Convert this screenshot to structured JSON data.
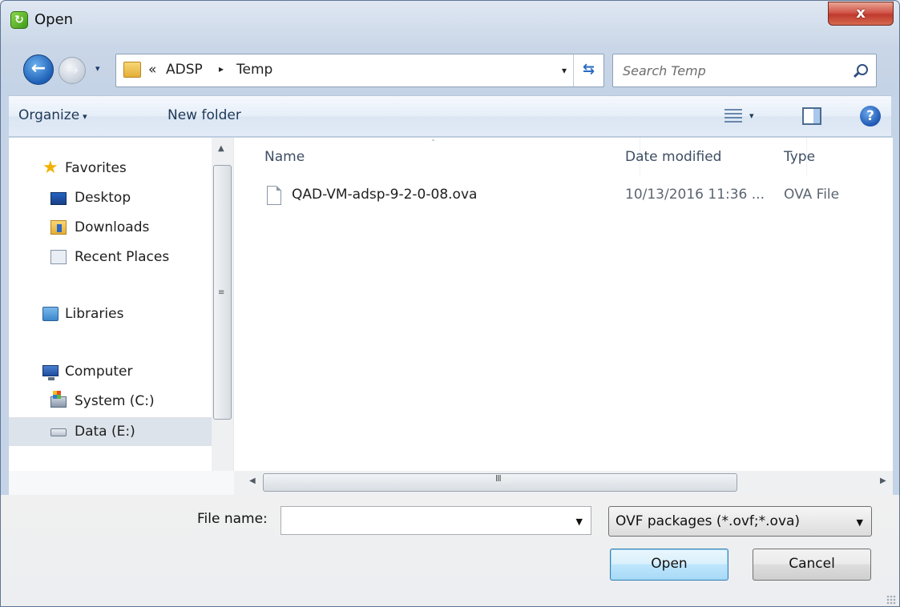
{
  "window": {
    "title": "Open",
    "close_label": "x"
  },
  "navigation": {
    "back_arrow": "←",
    "forward_arrow": "→",
    "history_caret": "▾",
    "breadcrumb": {
      "overflow": "«",
      "items": [
        "ADSP",
        "Temp"
      ],
      "separator": "▸"
    },
    "address_caret": "▾",
    "refresh_glyph": "⇆",
    "search_placeholder": "Search Temp"
  },
  "toolbar": {
    "organize_label": "Organize",
    "caret": "▾",
    "new_folder_label": "New folder",
    "view_caret": "▾",
    "help_glyph": "?"
  },
  "sidebar": {
    "favorites": "Favorites",
    "desktop": "Desktop",
    "downloads": "Downloads",
    "recent_places": "Recent Places",
    "libraries": "Libraries",
    "computer": "Computer",
    "system_drive": "System (C:)",
    "data_drive": "Data (E:)",
    "star_glyph": "★"
  },
  "file_list": {
    "columns": [
      "Name",
      "Date modified",
      "Type"
    ],
    "sort_glyph": "ˆ",
    "rows": [
      {
        "name": "QAD-VM-adsp-9-2-0-08.ova",
        "date_modified": "10/13/2016 11:36 ...",
        "type": "OVA File"
      }
    ]
  },
  "scrollbars": {
    "up": "▲",
    "down": "▼",
    "left": "◀",
    "right": "▶",
    "v_grip": "≡",
    "h_grip": "III"
  },
  "footer": {
    "file_name_label": "File name:",
    "file_name_value": "",
    "file_name_caret": "▼",
    "filter_value": "OVF packages (*.ovf;*.ova)",
    "filter_caret": "▼",
    "open_button": "Open",
    "cancel_button": "Cancel"
  },
  "colors": {
    "accent": "#3c7fb1",
    "close_button": "#c03a2e",
    "favorites_star": "#f2b100",
    "selected_row": "#dde3ea"
  },
  "icons": {
    "app": "vsphere-app-icon",
    "folder": "folder-icon",
    "search": "search-icon",
    "view": "view-details-icon",
    "preview": "preview-pane-icon",
    "help": "help-icon",
    "file": "file-icon"
  }
}
